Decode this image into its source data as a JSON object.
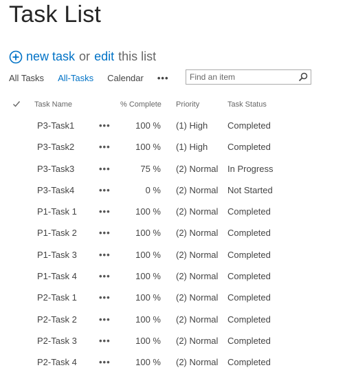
{
  "title": "Task List",
  "actions": {
    "new_label": "new task",
    "or_text": "or",
    "edit_label": "edit",
    "tail_text": "this list",
    "icon": "plus-circle-icon"
  },
  "views": {
    "items": [
      "All Tasks",
      "All-Tasks",
      "Calendar"
    ],
    "active": "All-Tasks",
    "more": "•••"
  },
  "search": {
    "placeholder": "Find an item",
    "value": "",
    "icon": "search-icon"
  },
  "columns": {
    "check_icon": "checkmark-icon",
    "name": "Task Name",
    "percent": "% Complete",
    "priority": "Priority",
    "status": "Task Status"
  },
  "tasks": [
    {
      "name": "P3-Task1",
      "more": "•••",
      "percent": "100 %",
      "priority": "(1) High",
      "status": "Completed"
    },
    {
      "name": "P3-Task2",
      "more": "•••",
      "percent": "100 %",
      "priority": "(1) High",
      "status": "Completed"
    },
    {
      "name": "P3-Task3",
      "more": "•••",
      "percent": "75 %",
      "priority": "(2) Normal",
      "status": "In Progress"
    },
    {
      "name": "P3-Task4",
      "more": "•••",
      "percent": "0 %",
      "priority": "(2) Normal",
      "status": "Not Started"
    },
    {
      "name": "P1-Task 1",
      "more": "•••",
      "percent": "100 %",
      "priority": "(2) Normal",
      "status": "Completed"
    },
    {
      "name": "P1-Task 2",
      "more": "•••",
      "percent": "100 %",
      "priority": "(2) Normal",
      "status": "Completed"
    },
    {
      "name": "P1-Task 3",
      "more": "•••",
      "percent": "100 %",
      "priority": "(2) Normal",
      "status": "Completed"
    },
    {
      "name": "P1-Task 4",
      "more": "•••",
      "percent": "100 %",
      "priority": "(2) Normal",
      "status": "Completed"
    },
    {
      "name": "P2-Task 1",
      "more": "•••",
      "percent": "100 %",
      "priority": "(2) Normal",
      "status": "Completed"
    },
    {
      "name": "P2-Task 2",
      "more": "•••",
      "percent": "100 %",
      "priority": "(2) Normal",
      "status": "Completed"
    },
    {
      "name": "P2-Task 3",
      "more": "•••",
      "percent": "100 %",
      "priority": "(2) Normal",
      "status": "Completed"
    },
    {
      "name": "P2-Task 4",
      "more": "•••",
      "percent": "100 %",
      "priority": "(2) Normal",
      "status": "Completed"
    }
  ],
  "colors": {
    "accent": "#0072c6",
    "title": "#262626",
    "text": "#444444"
  }
}
